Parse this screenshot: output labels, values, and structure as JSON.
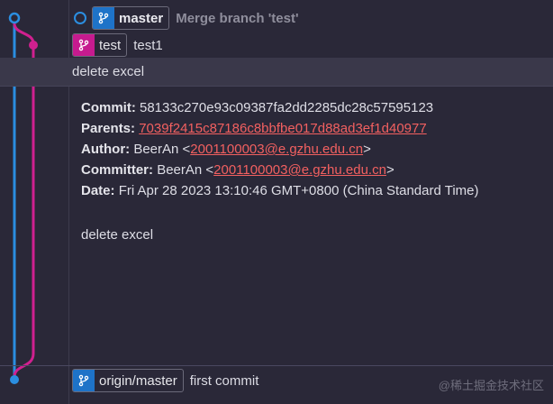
{
  "rows": [
    {
      "ref": {
        "label": "master",
        "icon": "branch-icon",
        "color": "#1e73c8",
        "is_head": true
      },
      "message": "Merge branch 'test'"
    },
    {
      "ref": {
        "label": "test",
        "icon": "branch-icon",
        "color": "#c61b8f"
      },
      "message": "test1"
    },
    {
      "message": "delete excel",
      "selected": true
    },
    {
      "ref": {
        "label": "origin/master",
        "icon": "branch-icon",
        "color": "#1e73c8"
      },
      "message": "first commit"
    }
  ],
  "details": {
    "commit_label": "Commit:",
    "commit": "58133c270e93c09387fa2dd2285dc28c57595123",
    "parents_label": "Parents:",
    "parents": "7039f2415c87186c8bbfbe017d88ad3ef1d40977",
    "author_label": "Author:",
    "author_name": "BeerAn <",
    "author_email": "2001100003@e.gzhu.edu.cn",
    "author_close": ">",
    "committer_label": "Committer:",
    "committer_name": "BeerAn <",
    "committer_email": "2001100003@e.gzhu.edu.cn",
    "committer_close": ">",
    "date_label": "Date:",
    "date": "Fri Apr 28 2023 13:10:46 GMT+0800 (China Standard Time)",
    "body": "delete excel"
  },
  "watermark": "@稀土掘金技术社区",
  "colors": {
    "blue_lane": "#2b8ee0",
    "pink_lane": "#d0208f",
    "link": "#f26060"
  }
}
